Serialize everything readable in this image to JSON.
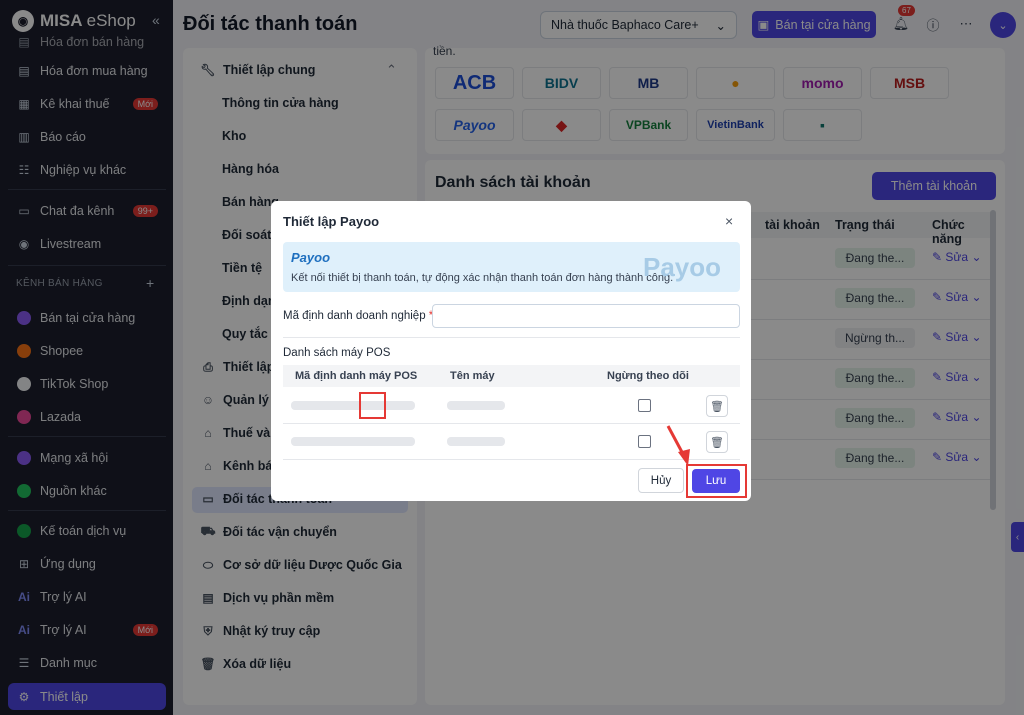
{
  "sidebar": {
    "brand": "MISA",
    "brand_suffix": "eShop",
    "collapse_glyph": "«",
    "items": [
      {
        "label": "Hóa đơn bán hàng",
        "icon": "receipt-icon"
      },
      {
        "label": "Hóa đơn mua hàng",
        "icon": "receipt-icon"
      },
      {
        "label": "Kê khai thuế",
        "icon": "tax-doc-icon",
        "badge": "Mới"
      },
      {
        "label": "Báo cáo",
        "icon": "report-icon"
      },
      {
        "label": "Nghiệp vụ khác",
        "icon": "grid-icon"
      },
      {
        "label": "Chat đa kênh",
        "icon": "chat-icon",
        "badge": "99+"
      },
      {
        "label": "Livestream",
        "icon": "livestream-icon"
      }
    ],
    "section": "KÊNH BÁN HÀNG",
    "channels": [
      {
        "label": "Bán tại cửa hàng",
        "color": "#8b5cf6"
      },
      {
        "label": "Shopee",
        "color": "#f97316"
      },
      {
        "label": "TikTok Shop",
        "color": "#111827"
      },
      {
        "label": "Lazada",
        "color": "#2563eb"
      }
    ],
    "more": [
      {
        "label": "Mạng xã hội",
        "icon": "social-icon"
      },
      {
        "label": "Nguồn khác",
        "icon": "source-icon"
      },
      {
        "label": "Kế toán dịch vụ",
        "icon": "accounting-icon"
      },
      {
        "label": "Ứng dụng",
        "icon": "apps-icon"
      },
      {
        "label": "Trợ lý AI",
        "icon": "ai-icon"
      },
      {
        "label": "Trợ lý AI",
        "icon": "ai-icon",
        "badge": "Mới"
      },
      {
        "label": "Danh mục",
        "icon": "list-icon"
      },
      {
        "label": "Thiết lập",
        "icon": "gear-icon",
        "active": true
      }
    ]
  },
  "header": {
    "title": "Đối tác thanh toán",
    "store": "Nhà thuốc Baphaco Care+",
    "sell_button": "Bán tại cửa hàng",
    "notification_count": "67"
  },
  "settings_menu": {
    "group": "Thiết lập chung",
    "subitems": [
      "Thông tin cửa hàng",
      "Kho",
      "Hàng hóa",
      "Bán hàng",
      "Đối soát",
      "Tiền tệ",
      "Định dạng",
      "Quy tắc"
    ],
    "items": [
      "Thiết lập",
      "Quản lý v",
      "Thuế và",
      "Kênh bán",
      "Đối tác thanh toán",
      "Đối tác vận chuyển",
      "Cơ sở dữ liệu Dược Quốc Gia",
      "Dịch vụ phần mềm",
      "Nhật ký truy cập",
      "Xóa dữ liệu"
    ]
  },
  "banks": {
    "intro": "tiền.",
    "items": [
      {
        "label": "ACB",
        "color": "#1d4ed8"
      },
      {
        "label": "BIDV",
        "color": "#0e7490"
      },
      {
        "label": "MB",
        "color": "#1e3a8a"
      },
      {
        "label": "",
        "color": "#f59e0b"
      },
      {
        "label": "momo",
        "color": "#a21caf"
      },
      {
        "label": "MSB",
        "color": "#b91c1c"
      },
      {
        "label": "Payoo",
        "color": "#2563eb"
      },
      {
        "label": "",
        "color": "#dc2626"
      },
      {
        "label": "VPBank",
        "color": "#15803d"
      },
      {
        "label": "VietinBank",
        "color": "#1e40af"
      },
      {
        "label": "",
        "color": "#0f766e"
      }
    ]
  },
  "accounts": {
    "title": "Danh sách tài khoản",
    "add_button": "Thêm tài khoản",
    "columns": [
      "tài khoản",
      "Trạng thái",
      "Chức năng"
    ],
    "rows": [
      {
        "status": "Đang the...",
        "edit": "Sửa"
      },
      {
        "status": "Đang the...",
        "edit": "Sửa"
      },
      {
        "status": "Ngừng th...",
        "edit": "Sửa"
      },
      {
        "status": "Đang the...",
        "edit": "Sửa"
      },
      {
        "status": "Đang the...",
        "edit": "Sửa"
      },
      {
        "status": "Đang the...",
        "edit": "Sửa"
      }
    ]
  },
  "modal": {
    "title": "Thiết lập Payoo",
    "close_glyph": "×",
    "banner_logo": "Payoo",
    "banner_text": "Kết nối thiết bị thanh toán, tự động xác nhận thanh toán đơn hàng thành công.",
    "banner_watermark": "Payoo",
    "field_label": "Mã định danh doanh nghiệp",
    "required_mark": "*",
    "pos_label": "Danh sách máy POS",
    "pos_columns": [
      "Mã định danh máy POS",
      "Tên máy",
      "Ngừng theo dõi"
    ],
    "pos_rows": [
      {
        "checked": false
      },
      {
        "checked": false
      }
    ],
    "cancel": "Hủy",
    "save": "Lưu"
  }
}
